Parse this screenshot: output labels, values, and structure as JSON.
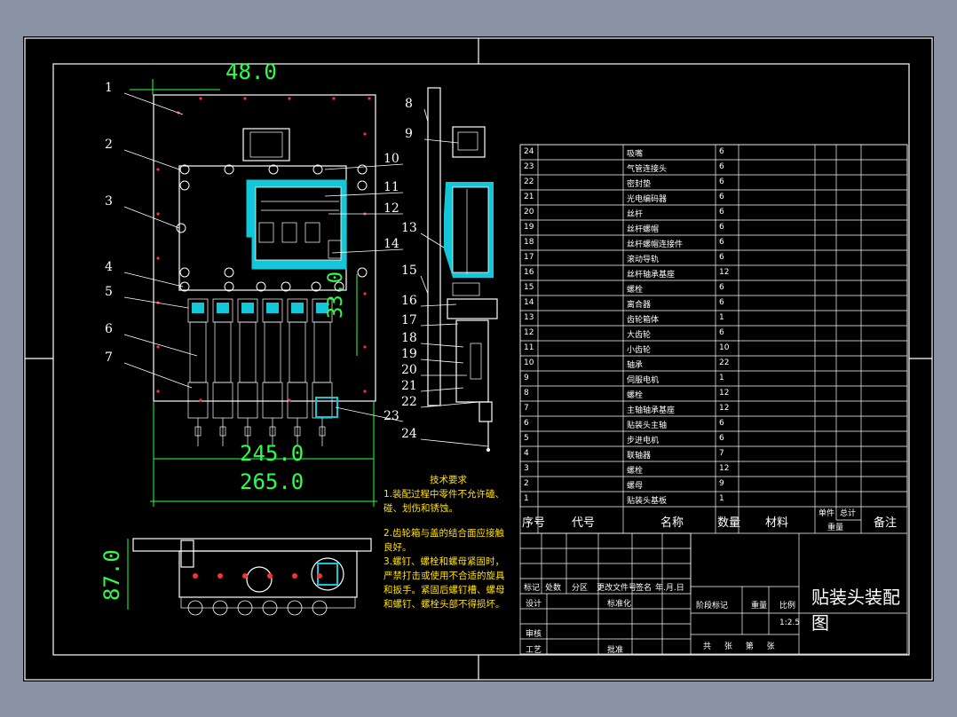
{
  "drawing": {
    "title": "贴装头装配图",
    "scale": "1:2.5",
    "sheet_text": "共 张 第 张"
  },
  "dimensions": {
    "d48": "48.0",
    "d33": "33.0",
    "d245": "245.0",
    "d265": "265.0",
    "d87": "87.0"
  },
  "leaders": [
    "1",
    "2",
    "3",
    "4",
    "5",
    "6",
    "7",
    "8",
    "9",
    "10",
    "11",
    "12",
    "13",
    "14",
    "15",
    "16",
    "17",
    "18",
    "19",
    "20",
    "21",
    "22",
    "23",
    "24"
  ],
  "notes": {
    "heading": "技术要求",
    "lines": [
      "1.装配过程中零件不允许磕、",
      "碰、划伤和锈蚀。",
      "2.齿轮箱与盖的结合面应接触",
      "良好。",
      "3.螺钉、螺栓和螺母紧固时，",
      "严禁打击或使用不合适的旋具",
      "和扳手。紧固后螺钉槽、螺母",
      "和螺钉、螺栓头部不得损坏。"
    ]
  },
  "bom": {
    "rows": [
      {
        "no": "24",
        "name": "吸嘴",
        "qty": "6"
      },
      {
        "no": "23",
        "name": "气管连接头",
        "qty": "6"
      },
      {
        "no": "22",
        "name": "密封垫",
        "qty": "6"
      },
      {
        "no": "21",
        "name": "光电编码器",
        "qty": "6"
      },
      {
        "no": "20",
        "name": "丝杆",
        "qty": "6"
      },
      {
        "no": "19",
        "name": "丝杆螺帽",
        "qty": "6"
      },
      {
        "no": "18",
        "name": "丝杆螺帽连接件",
        "qty": "6"
      },
      {
        "no": "17",
        "name": "滚动导轨",
        "qty": "6"
      },
      {
        "no": "16",
        "name": "丝杆轴承基座",
        "qty": "12"
      },
      {
        "no": "15",
        "name": "螺栓",
        "qty": "6"
      },
      {
        "no": "14",
        "name": "离合器",
        "qty": "6"
      },
      {
        "no": "13",
        "name": "齿轮箱体",
        "qty": "1"
      },
      {
        "no": "12",
        "name": "大齿轮",
        "qty": "6"
      },
      {
        "no": "11",
        "name": "小齿轮",
        "qty": "10"
      },
      {
        "no": "10",
        "name": "轴承",
        "qty": "22"
      },
      {
        "no": "9",
        "name": "伺服电机",
        "qty": "1"
      },
      {
        "no": "8",
        "name": "螺栓",
        "qty": "12"
      },
      {
        "no": "7",
        "name": "主轴轴承基座",
        "qty": "12"
      },
      {
        "no": "6",
        "name": "贴装头主轴",
        "qty": "6"
      },
      {
        "no": "5",
        "name": "步进电机",
        "qty": "6"
      },
      {
        "no": "4",
        "name": "联轴器",
        "qty": "7"
      },
      {
        "no": "3",
        "name": "螺栓",
        "qty": "12"
      },
      {
        "no": "2",
        "name": "螺母",
        "qty": "9"
      },
      {
        "no": "1",
        "name": "贴装头基板",
        "qty": "1"
      }
    ],
    "header": {
      "no": "序号",
      "code": "代号",
      "name": "名称",
      "qty": "数量",
      "material": "材料",
      "unit": "单件",
      "total": "总计",
      "weight": "重量",
      "remark": "备注"
    }
  },
  "title_block": {
    "mark": "标记",
    "count": "处数",
    "zone": "分区",
    "change_doc": "更改文件号",
    "sign": "签名",
    "date": "年.月.日",
    "design": "设计",
    "standard": "标准化",
    "review": "审核",
    "process": "工艺",
    "approve": "批准",
    "stage": "阶段标记",
    "weight": "重量",
    "ratio": "比例"
  }
}
